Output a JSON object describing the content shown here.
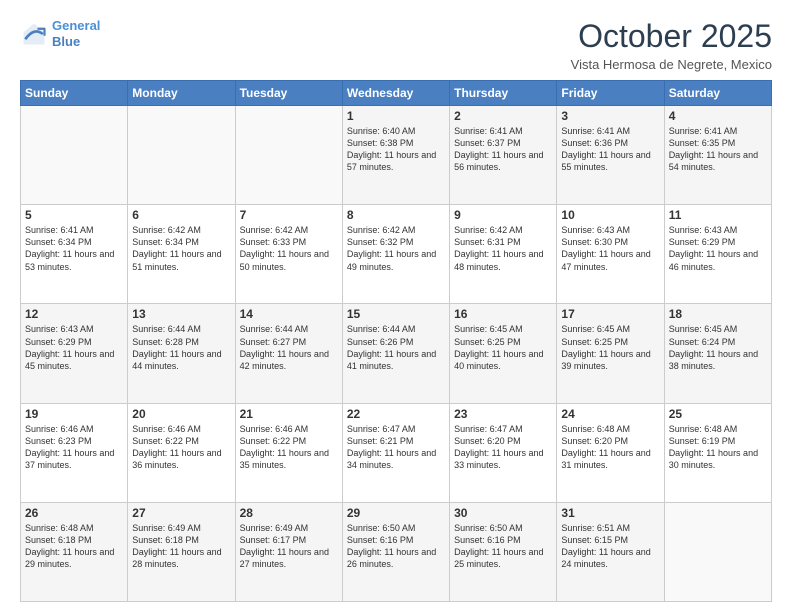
{
  "logo": {
    "line1": "General",
    "line2": "Blue"
  },
  "title": "October 2025",
  "subtitle": "Vista Hermosa de Negrete, Mexico",
  "days_header": [
    "Sunday",
    "Monday",
    "Tuesday",
    "Wednesday",
    "Thursday",
    "Friday",
    "Saturday"
  ],
  "weeks": [
    [
      {
        "day": "",
        "info": ""
      },
      {
        "day": "",
        "info": ""
      },
      {
        "day": "",
        "info": ""
      },
      {
        "day": "1",
        "info": "Sunrise: 6:40 AM\nSunset: 6:38 PM\nDaylight: 11 hours and 57 minutes."
      },
      {
        "day": "2",
        "info": "Sunrise: 6:41 AM\nSunset: 6:37 PM\nDaylight: 11 hours and 56 minutes."
      },
      {
        "day": "3",
        "info": "Sunrise: 6:41 AM\nSunset: 6:36 PM\nDaylight: 11 hours and 55 minutes."
      },
      {
        "day": "4",
        "info": "Sunrise: 6:41 AM\nSunset: 6:35 PM\nDaylight: 11 hours and 54 minutes."
      }
    ],
    [
      {
        "day": "5",
        "info": "Sunrise: 6:41 AM\nSunset: 6:34 PM\nDaylight: 11 hours and 53 minutes."
      },
      {
        "day": "6",
        "info": "Sunrise: 6:42 AM\nSunset: 6:34 PM\nDaylight: 11 hours and 51 minutes."
      },
      {
        "day": "7",
        "info": "Sunrise: 6:42 AM\nSunset: 6:33 PM\nDaylight: 11 hours and 50 minutes."
      },
      {
        "day": "8",
        "info": "Sunrise: 6:42 AM\nSunset: 6:32 PM\nDaylight: 11 hours and 49 minutes."
      },
      {
        "day": "9",
        "info": "Sunrise: 6:42 AM\nSunset: 6:31 PM\nDaylight: 11 hours and 48 minutes."
      },
      {
        "day": "10",
        "info": "Sunrise: 6:43 AM\nSunset: 6:30 PM\nDaylight: 11 hours and 47 minutes."
      },
      {
        "day": "11",
        "info": "Sunrise: 6:43 AM\nSunset: 6:29 PM\nDaylight: 11 hours and 46 minutes."
      }
    ],
    [
      {
        "day": "12",
        "info": "Sunrise: 6:43 AM\nSunset: 6:29 PM\nDaylight: 11 hours and 45 minutes."
      },
      {
        "day": "13",
        "info": "Sunrise: 6:44 AM\nSunset: 6:28 PM\nDaylight: 11 hours and 44 minutes."
      },
      {
        "day": "14",
        "info": "Sunrise: 6:44 AM\nSunset: 6:27 PM\nDaylight: 11 hours and 42 minutes."
      },
      {
        "day": "15",
        "info": "Sunrise: 6:44 AM\nSunset: 6:26 PM\nDaylight: 11 hours and 41 minutes."
      },
      {
        "day": "16",
        "info": "Sunrise: 6:45 AM\nSunset: 6:25 PM\nDaylight: 11 hours and 40 minutes."
      },
      {
        "day": "17",
        "info": "Sunrise: 6:45 AM\nSunset: 6:25 PM\nDaylight: 11 hours and 39 minutes."
      },
      {
        "day": "18",
        "info": "Sunrise: 6:45 AM\nSunset: 6:24 PM\nDaylight: 11 hours and 38 minutes."
      }
    ],
    [
      {
        "day": "19",
        "info": "Sunrise: 6:46 AM\nSunset: 6:23 PM\nDaylight: 11 hours and 37 minutes."
      },
      {
        "day": "20",
        "info": "Sunrise: 6:46 AM\nSunset: 6:22 PM\nDaylight: 11 hours and 36 minutes."
      },
      {
        "day": "21",
        "info": "Sunrise: 6:46 AM\nSunset: 6:22 PM\nDaylight: 11 hours and 35 minutes."
      },
      {
        "day": "22",
        "info": "Sunrise: 6:47 AM\nSunset: 6:21 PM\nDaylight: 11 hours and 34 minutes."
      },
      {
        "day": "23",
        "info": "Sunrise: 6:47 AM\nSunset: 6:20 PM\nDaylight: 11 hours and 33 minutes."
      },
      {
        "day": "24",
        "info": "Sunrise: 6:48 AM\nSunset: 6:20 PM\nDaylight: 11 hours and 31 minutes."
      },
      {
        "day": "25",
        "info": "Sunrise: 6:48 AM\nSunset: 6:19 PM\nDaylight: 11 hours and 30 minutes."
      }
    ],
    [
      {
        "day": "26",
        "info": "Sunrise: 6:48 AM\nSunset: 6:18 PM\nDaylight: 11 hours and 29 minutes."
      },
      {
        "day": "27",
        "info": "Sunrise: 6:49 AM\nSunset: 6:18 PM\nDaylight: 11 hours and 28 minutes."
      },
      {
        "day": "28",
        "info": "Sunrise: 6:49 AM\nSunset: 6:17 PM\nDaylight: 11 hours and 27 minutes."
      },
      {
        "day": "29",
        "info": "Sunrise: 6:50 AM\nSunset: 6:16 PM\nDaylight: 11 hours and 26 minutes."
      },
      {
        "day": "30",
        "info": "Sunrise: 6:50 AM\nSunset: 6:16 PM\nDaylight: 11 hours and 25 minutes."
      },
      {
        "day": "31",
        "info": "Sunrise: 6:51 AM\nSunset: 6:15 PM\nDaylight: 11 hours and 24 minutes."
      },
      {
        "day": "",
        "info": ""
      }
    ]
  ]
}
